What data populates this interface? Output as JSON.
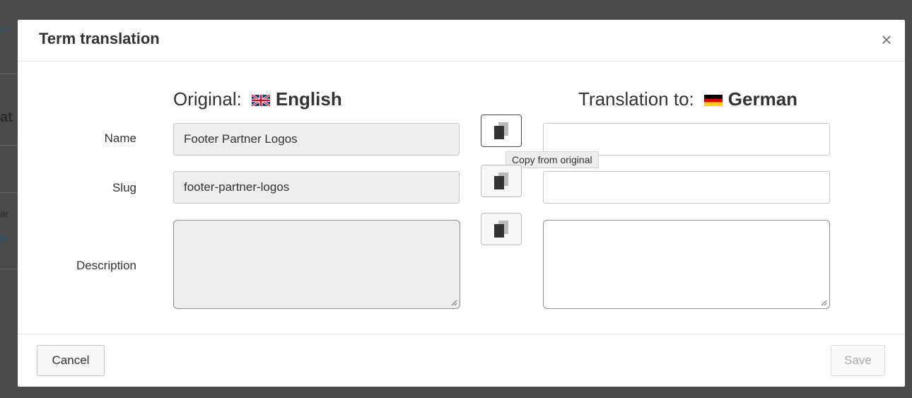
{
  "background": {
    "fragments": [
      "oc",
      "at",
      "ar",
      "je"
    ]
  },
  "modal": {
    "title": "Term translation",
    "close_glyph": "×",
    "original": {
      "prefix": "Original:",
      "language": "English",
      "flag_icon": "uk-flag-icon"
    },
    "translation": {
      "prefix": "Translation to:",
      "language": "German",
      "flag_icon": "germany-flag-icon"
    },
    "rows": {
      "name": {
        "label": "Name",
        "original_value": "Footer Partner Logos",
        "translation_value": ""
      },
      "slug": {
        "label": "Slug",
        "original_value": "footer-partner-logos",
        "translation_value": ""
      },
      "description": {
        "label": "Description",
        "original_value": "",
        "translation_value": ""
      }
    },
    "copy_icon": "copy-icon",
    "tooltip": "Copy from original",
    "footer": {
      "cancel_label": "Cancel",
      "save_label": "Save"
    }
  },
  "colors": {
    "overlay": "#4a4a4a",
    "readonly_field": "#eeeeee",
    "save_disabled_text": "#a9a9a9"
  }
}
